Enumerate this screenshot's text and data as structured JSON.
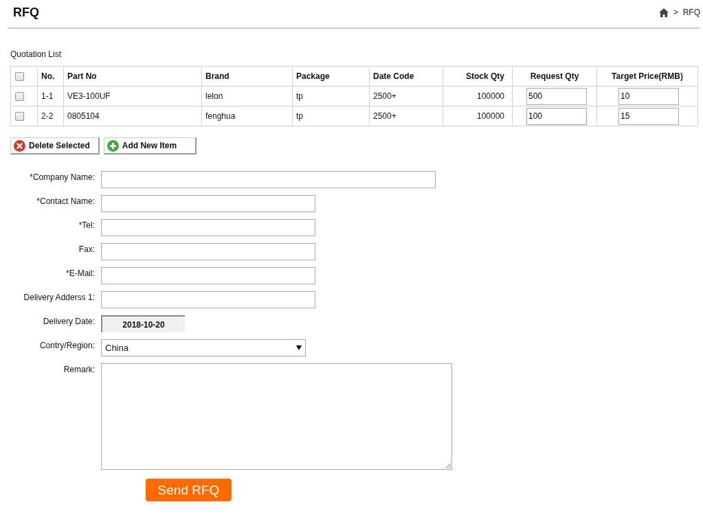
{
  "header": {
    "title": "RFQ",
    "breadcrumb_separator": ">",
    "breadcrumb_current": "RFQ"
  },
  "quotation": {
    "title": "Quotation List",
    "columns": [
      {
        "kind": "check",
        "checked": false
      },
      {
        "label": "No.",
        "kind": "text"
      },
      {
        "label": "Part No",
        "kind": "text"
      },
      {
        "label": "Brand",
        "kind": "text"
      },
      {
        "label": "Package",
        "kind": "text"
      },
      {
        "label": "Date Code",
        "kind": "text"
      },
      {
        "label": "Stock Qty",
        "kind": "number"
      },
      {
        "label": "Request Qty",
        "kind": "input"
      },
      {
        "label": "Target Price(RMB)",
        "kind": "input"
      }
    ],
    "rows": [
      {
        "checked": false,
        "no": "1-1",
        "part_no": "VE3-100UF",
        "brand": "lelon",
        "package": "tp",
        "date_code": "2500+",
        "stock_qty": "100000",
        "request_qty": {
          "value": "500",
          "focused": false
        },
        "target_price": {
          "value": "10",
          "focused": false
        }
      },
      {
        "checked": false,
        "no": "2-2",
        "part_no": "0805104",
        "brand": "fenghua",
        "package": "tp",
        "date_code": "2500+",
        "stock_qty": "100000",
        "request_qty": {
          "value": "100",
          "focused": true
        },
        "target_price": {
          "value": "15",
          "focused": false
        }
      }
    ],
    "buttons": [
      {
        "label": "Delete Selected",
        "kind": "delete"
      },
      {
        "label": "Add New Item",
        "kind": "add"
      }
    ]
  },
  "form": {
    "fields": [
      {
        "label": "*Company Name:",
        "kind": "wide"
      },
      {
        "label": "*Contact Name:",
        "kind": "text"
      },
      {
        "label": "*Tel:",
        "kind": "text"
      },
      {
        "label": "Fax:",
        "kind": "text"
      },
      {
        "label": "*E-Mail:",
        "kind": "text"
      },
      {
        "label": "Delivery Adderss 1:",
        "kind": "text"
      },
      {
        "label": "Delivery Date:",
        "kind": "date",
        "value": "2018-10-20"
      },
      {
        "label": "Contry/Region:",
        "kind": "select",
        "value": "China"
      },
      {
        "label": "Remark:",
        "kind": "textarea"
      }
    ],
    "submit": "Send RFQ"
  }
}
